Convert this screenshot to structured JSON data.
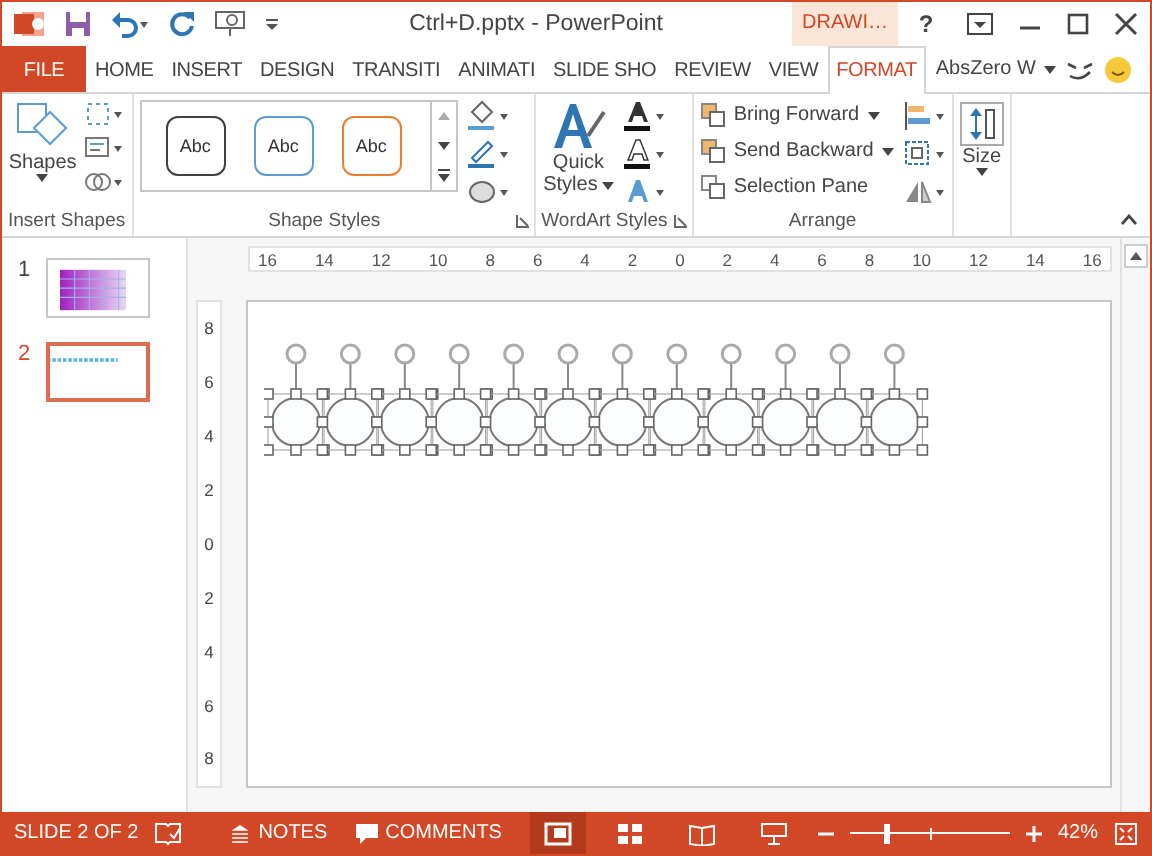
{
  "title_bar": {
    "title": "Ctrl+D.pptx - PowerPoint",
    "context_tab": "DRAWI…",
    "help": "?"
  },
  "tabs": [
    {
      "label": "FILE",
      "kind": "file",
      "selected": false
    },
    {
      "label": "HOME",
      "kind": "tab",
      "selected": false
    },
    {
      "label": "INSERT",
      "kind": "tab",
      "selected": false
    },
    {
      "label": "DESIGN",
      "kind": "tab",
      "selected": false
    },
    {
      "label": "TRANSITI",
      "kind": "tab",
      "selected": false
    },
    {
      "label": "ANIMATI",
      "kind": "tab",
      "selected": false
    },
    {
      "label": "SLIDE SHO",
      "kind": "tab",
      "selected": false
    },
    {
      "label": "REVIEW",
      "kind": "tab",
      "selected": false
    },
    {
      "label": "VIEW",
      "kind": "tab",
      "selected": false
    },
    {
      "label": "FORMAT",
      "kind": "tab",
      "selected": true
    }
  ],
  "account": "AbsZero W",
  "ribbon": {
    "insert_shapes": {
      "shapes_button": "Shapes",
      "label": "Insert Shapes"
    },
    "shape_styles": {
      "styles": [
        {
          "label": "Abc",
          "color": "#404040"
        },
        {
          "label": "Abc",
          "color": "#5b9bd5"
        },
        {
          "label": "Abc",
          "color": "#ed7d31"
        }
      ],
      "label": "Shape Styles"
    },
    "wordart_styles": {
      "quick_styles": [
        "Quick",
        "Styles"
      ],
      "label": "WordArt Styles"
    },
    "arrange": {
      "buttons": [
        "Bring Forward",
        "Send Backward",
        "Selection Pane"
      ],
      "label": "Arrange"
    },
    "size": {
      "button": "Size"
    }
  },
  "slides": [
    {
      "number": "1",
      "selected": false
    },
    {
      "number": "2",
      "selected": true
    }
  ],
  "horizontal_ruler": [
    "16",
    "14",
    "12",
    "10",
    "8",
    "6",
    "4",
    "2",
    "0",
    "2",
    "4",
    "6",
    "8",
    "10",
    "12",
    "14",
    "16"
  ],
  "vertical_ruler": [
    "8",
    "6",
    "4",
    "2",
    "0",
    "2",
    "4",
    "6",
    "8"
  ],
  "status_bar": {
    "slide_info": "SLIDE 2 OF 2",
    "notes": "NOTES",
    "comments": "COMMENTS",
    "views": [
      {
        "kind": "normal",
        "selected": true
      },
      {
        "kind": "sorter",
        "selected": false
      },
      {
        "kind": "reading",
        "selected": false
      },
      {
        "kind": "slideshow",
        "selected": false
      }
    ],
    "zoom": {
      "level": 0.23
    },
    "zoom_text": "42%"
  }
}
